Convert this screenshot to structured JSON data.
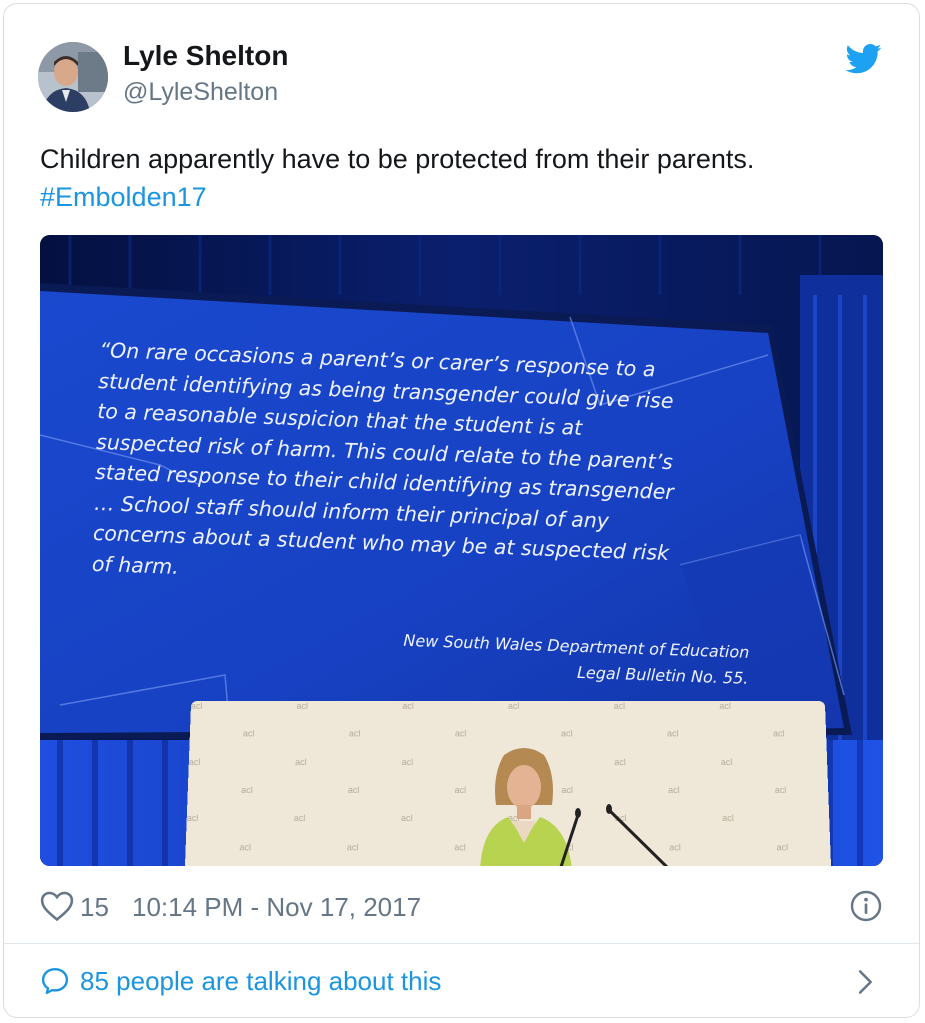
{
  "author": {
    "name": "Lyle Shelton",
    "handle": "@LyleShelton"
  },
  "tweet": {
    "text": "Children apparently have to be protected from their parents.",
    "hashtag": "#Embolden17"
  },
  "slide": {
    "quote_lines": [
      "“On rare occasions a parent’s or carer’s response to a",
      "student identifying as being transgender could give rise",
      "to a reasonable suspicion that the student is at",
      "suspected risk of harm. This could relate to the parent’s",
      "stated response to their child identifying as transgender",
      "… School staff should inform their principal of any",
      "concerns about a student who may be at suspected risk",
      "of harm."
    ],
    "source_line1": "New South Wales Department of Education",
    "source_line2": "Legal Bulletin No. 55.",
    "podium_logo": "acl"
  },
  "meta": {
    "like_count": "15",
    "timestamp": "10:14 PM - Nov 17, 2017"
  },
  "footer": {
    "talking_text": "85 people are talking about this"
  },
  "colors": {
    "link_blue": "#1b95e0",
    "twitter_blue": "#1da1f2",
    "muted_gray": "#657786",
    "slide_blue": "#1742c4"
  },
  "icons": [
    "twitter-bird-icon",
    "heart-icon",
    "info-icon",
    "speech-bubble-icon",
    "chevron-right-icon"
  ]
}
